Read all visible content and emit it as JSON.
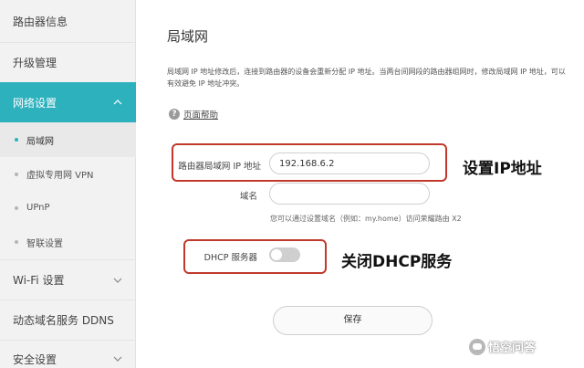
{
  "sidebar": {
    "items": [
      {
        "label": "路由器信息"
      },
      {
        "label": "升级管理"
      },
      {
        "label": "网络设置"
      },
      {
        "label": "局域网"
      },
      {
        "label": "虚拟专用网 VPN"
      },
      {
        "label": "UPnP"
      },
      {
        "label": "智联设置"
      },
      {
        "label": "Wi-Fi 设置"
      },
      {
        "label": "动态域名服务 DDNS"
      },
      {
        "label": "安全设置"
      }
    ]
  },
  "main": {
    "title": "局域网",
    "description": "局域网 IP 地址修改后，连接到路由器的设备会重新分配 IP 地址。当两台间网段的路由器组网时，修改局域网 IP 地址，可以有效避免 IP 地址冲突。",
    "help_label": "页面帮助",
    "help_icon": "?",
    "ip_label": "路由器局域网 IP 地址",
    "ip_value": "192.168.6.2",
    "domain_label": "域名",
    "domain_value": "",
    "domain_hint": "您可以通过设置域名（例如：my.home）访问荣耀路由 X2",
    "dhcp_label": "DHCP 服务器",
    "dhcp_enabled": false,
    "save_label": "保存"
  },
  "annotations": {
    "ip_note": "设置IP地址",
    "dhcp_note": "关闭DHCP服务"
  },
  "colors": {
    "accent": "#2cb1bd",
    "highlight_border": "#c0392b"
  },
  "watermark": {
    "text": "悟空问答"
  }
}
